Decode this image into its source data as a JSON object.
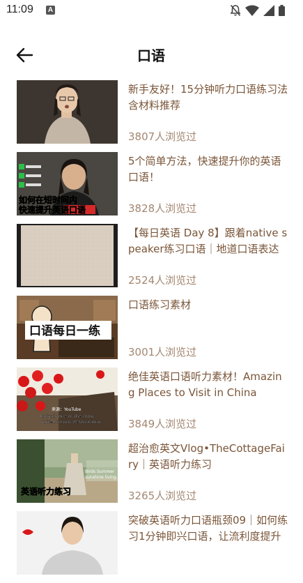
{
  "status": {
    "time": "11:09",
    "app_badge": "A"
  },
  "header": {
    "title": "口语"
  },
  "items": [
    {
      "title": "新手友好！15分钟听力口语练习法 含材料推荐",
      "views": "3807人浏览过"
    },
    {
      "title": "5个简单方法，快速提升你的英语口语！",
      "views": "3828人浏览过",
      "thumb_text": "如何在短时间内\n快速提升英语口语"
    },
    {
      "title": "【每日英语 Day 8】跟着native speaker练习口语｜地道口语表达",
      "views": "2524人浏览过"
    },
    {
      "title": "口语练习素材",
      "views": "3001人浏览过",
      "thumb_text": "口语每日一练"
    },
    {
      "title": "绝佳英语口语听力素材！Amazing Places to Visit in China",
      "views": "3849人浏览过",
      "thumb_text": "Chinais one of the most visited tourist destinations"
    },
    {
      "title": "超治愈英文Vlog•TheCottageFairy｜英语听力练习",
      "views": "3265人浏览过",
      "thumb_text": "英语听力练习"
    },
    {
      "title": "突破英语听力口语瓶颈09｜如何练习1分钟即兴口语，让流利度提升",
      "views": ""
    }
  ]
}
